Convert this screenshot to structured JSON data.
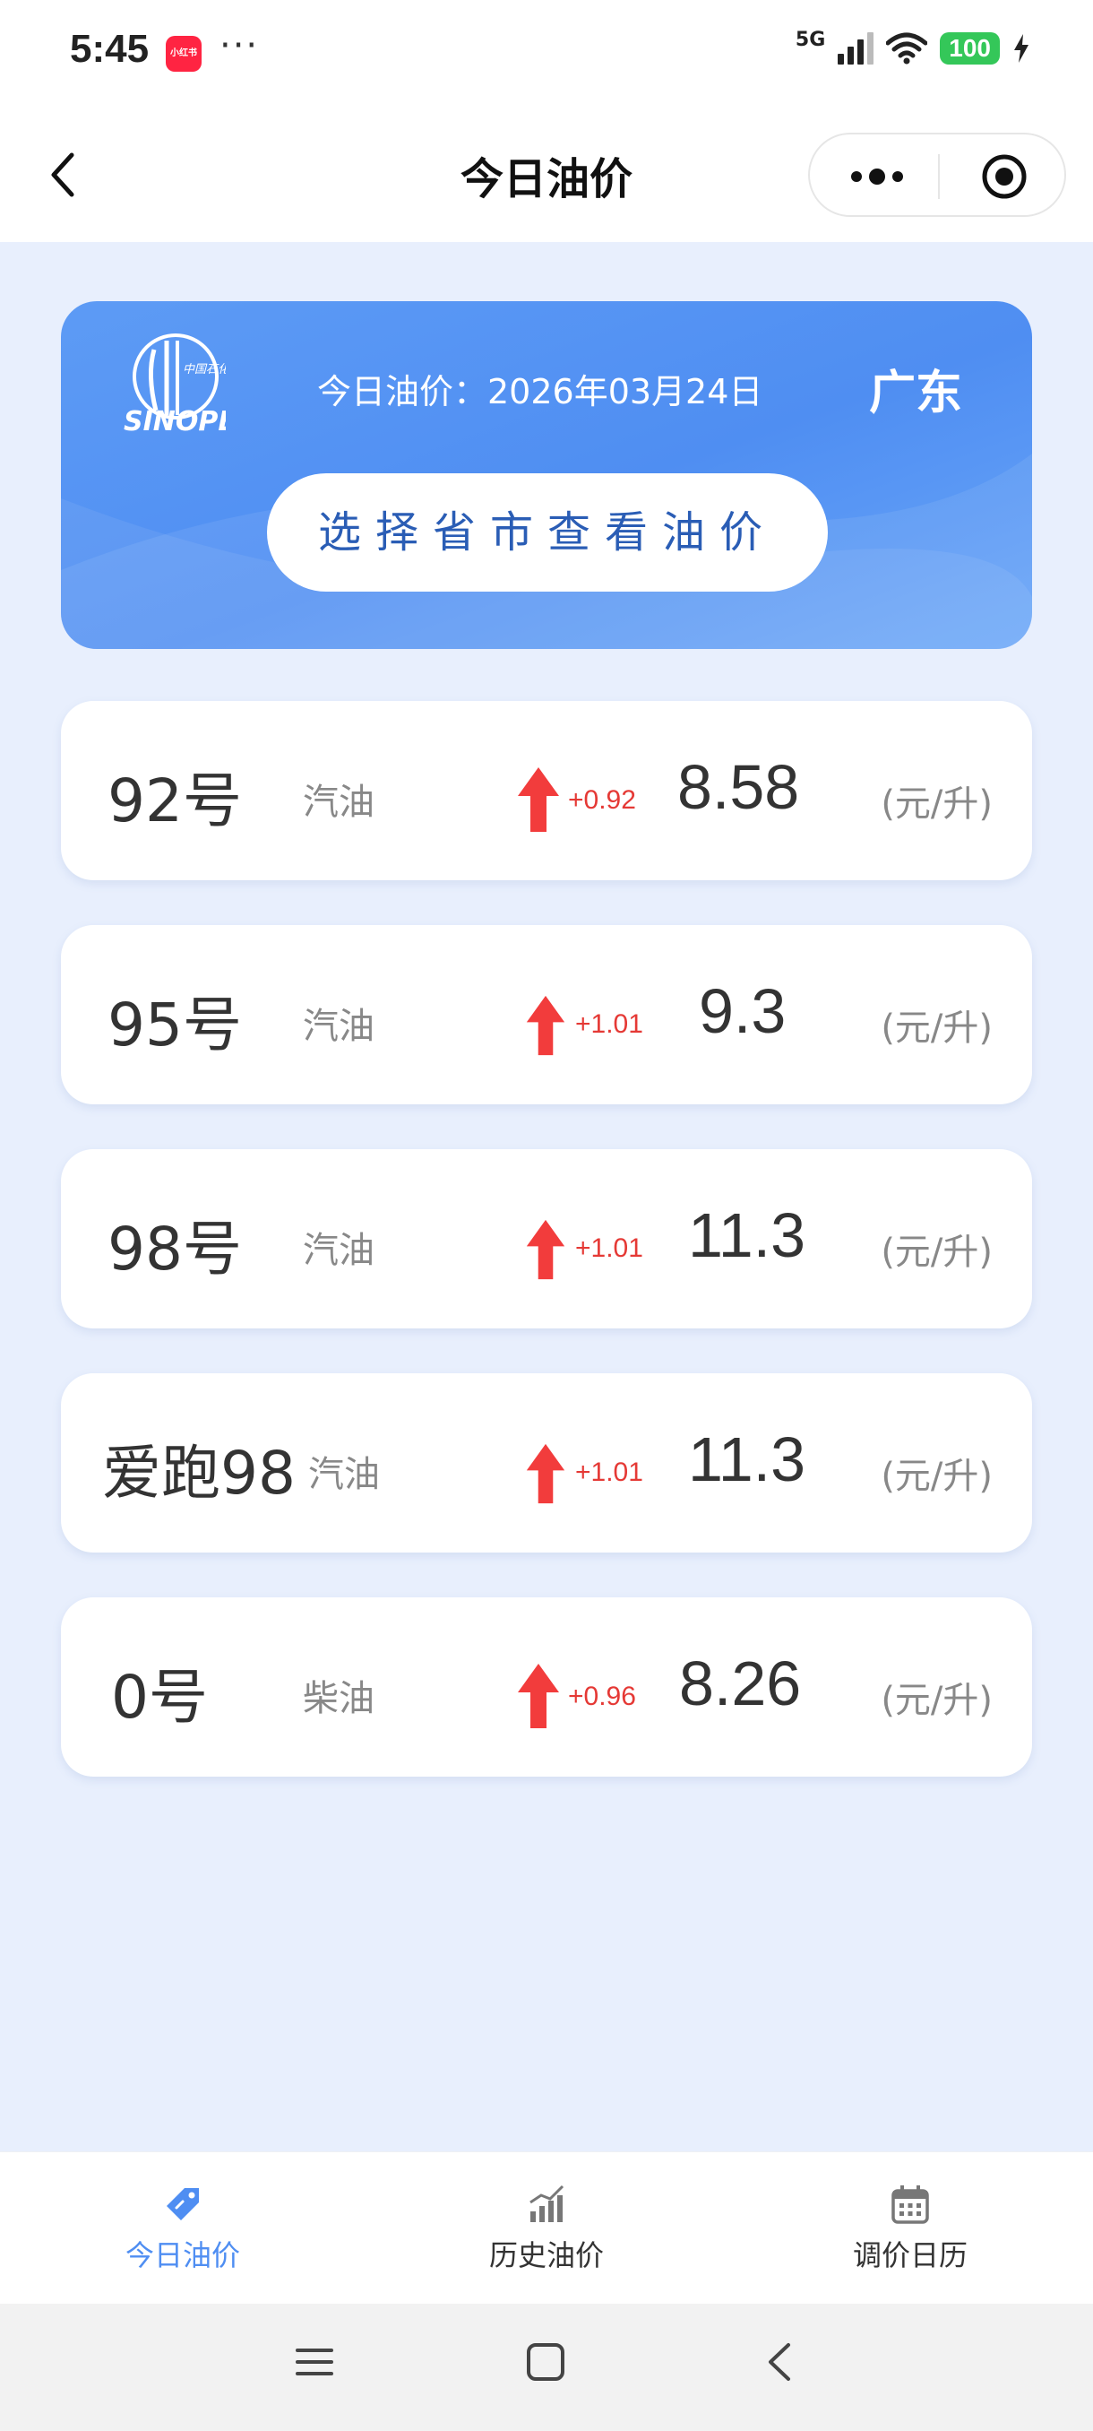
{
  "status_bar": {
    "time": "5:45",
    "app_badge": "小红书",
    "network": "5G",
    "battery": "100"
  },
  "nav": {
    "title": "今日油价"
  },
  "header": {
    "date_text": "今日油价：2026年03月24日",
    "province": "广东",
    "select_button": "选择省市查看油价"
  },
  "prices": [
    {
      "grade": "92号",
      "type": "汽油",
      "change": "+0.92",
      "price": "8.58",
      "unit": "(元/升)"
    },
    {
      "grade": "95号",
      "type": "汽油",
      "change": "+1.01",
      "price": "9.3",
      "unit": "(元/升)"
    },
    {
      "grade": "98号",
      "type": "汽油",
      "change": "+1.01",
      "price": "11.3",
      "unit": "(元/升)"
    },
    {
      "grade": "爱跑98",
      "type": "汽油",
      "change": "+1.01",
      "price": "11.3",
      "unit": "(元/升)"
    },
    {
      "grade": "0号",
      "type": "柴油",
      "change": "+0.96",
      "price": "8.26",
      "unit": "(元/升)"
    }
  ],
  "tabs": [
    {
      "label": "今日油价",
      "icon": "price-tag-icon",
      "active": true
    },
    {
      "label": "历史油价",
      "icon": "chart-bars-icon",
      "active": false
    },
    {
      "label": "调价日历",
      "icon": "calendar-icon",
      "active": false
    }
  ],
  "colors": {
    "accent": "#4f8ef2",
    "increase": "#e53935",
    "page_bg": "#e8effd"
  }
}
